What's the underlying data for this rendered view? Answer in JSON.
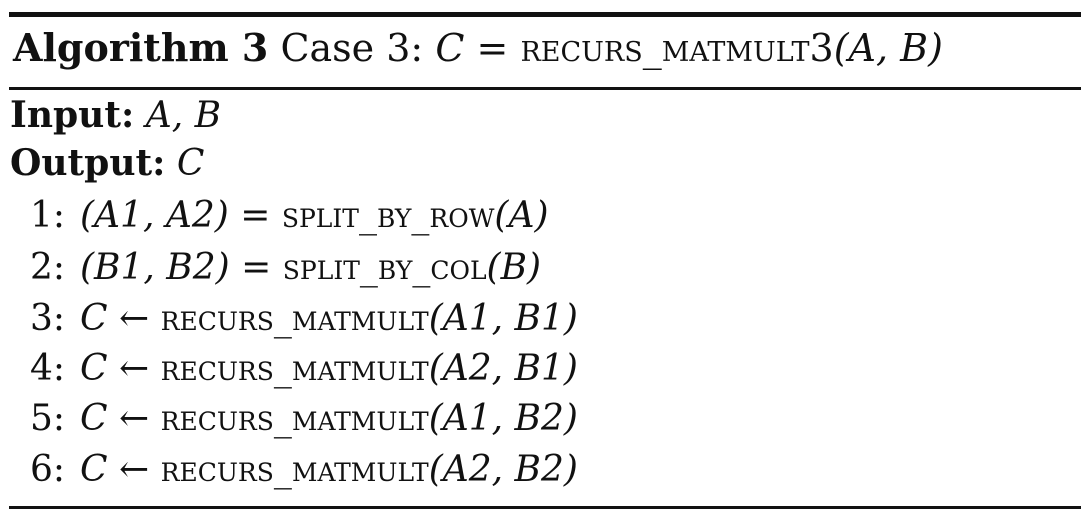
{
  "algorithm": {
    "label": "Algorithm 3",
    "caption_prefix": "Case 3:",
    "caption_lhs": "C",
    "caption_eq": "=",
    "caption_fn": "recurs_matmult3",
    "caption_args": "(A, B)"
  },
  "io": {
    "input_label": "Input:",
    "input_value": "A, B",
    "output_label": "Output:",
    "output_value": "C"
  },
  "lines": [
    {
      "num": "1:",
      "lhs": "(A1, A2)",
      "op": "=",
      "fn": "split_by_row",
      "args": "(A)"
    },
    {
      "num": "2:",
      "lhs": "(B1, B2)",
      "op": "=",
      "fn": "split_by_col",
      "args": "(B)"
    },
    {
      "num": "3:",
      "lhs": "C",
      "op": "←",
      "fn": "recurs_matmult",
      "args": "(A1, B1)"
    },
    {
      "num": "4:",
      "lhs": "C",
      "op": "←",
      "fn": "recurs_matmult",
      "args": "(A2, B1)"
    },
    {
      "num": "5:",
      "lhs": "C",
      "op": "←",
      "fn": "recurs_matmult",
      "args": "(A1, B2)"
    },
    {
      "num": "6:",
      "lhs": "C",
      "op": "←",
      "fn": "recurs_matmult",
      "args": "(A2, B2)"
    }
  ]
}
